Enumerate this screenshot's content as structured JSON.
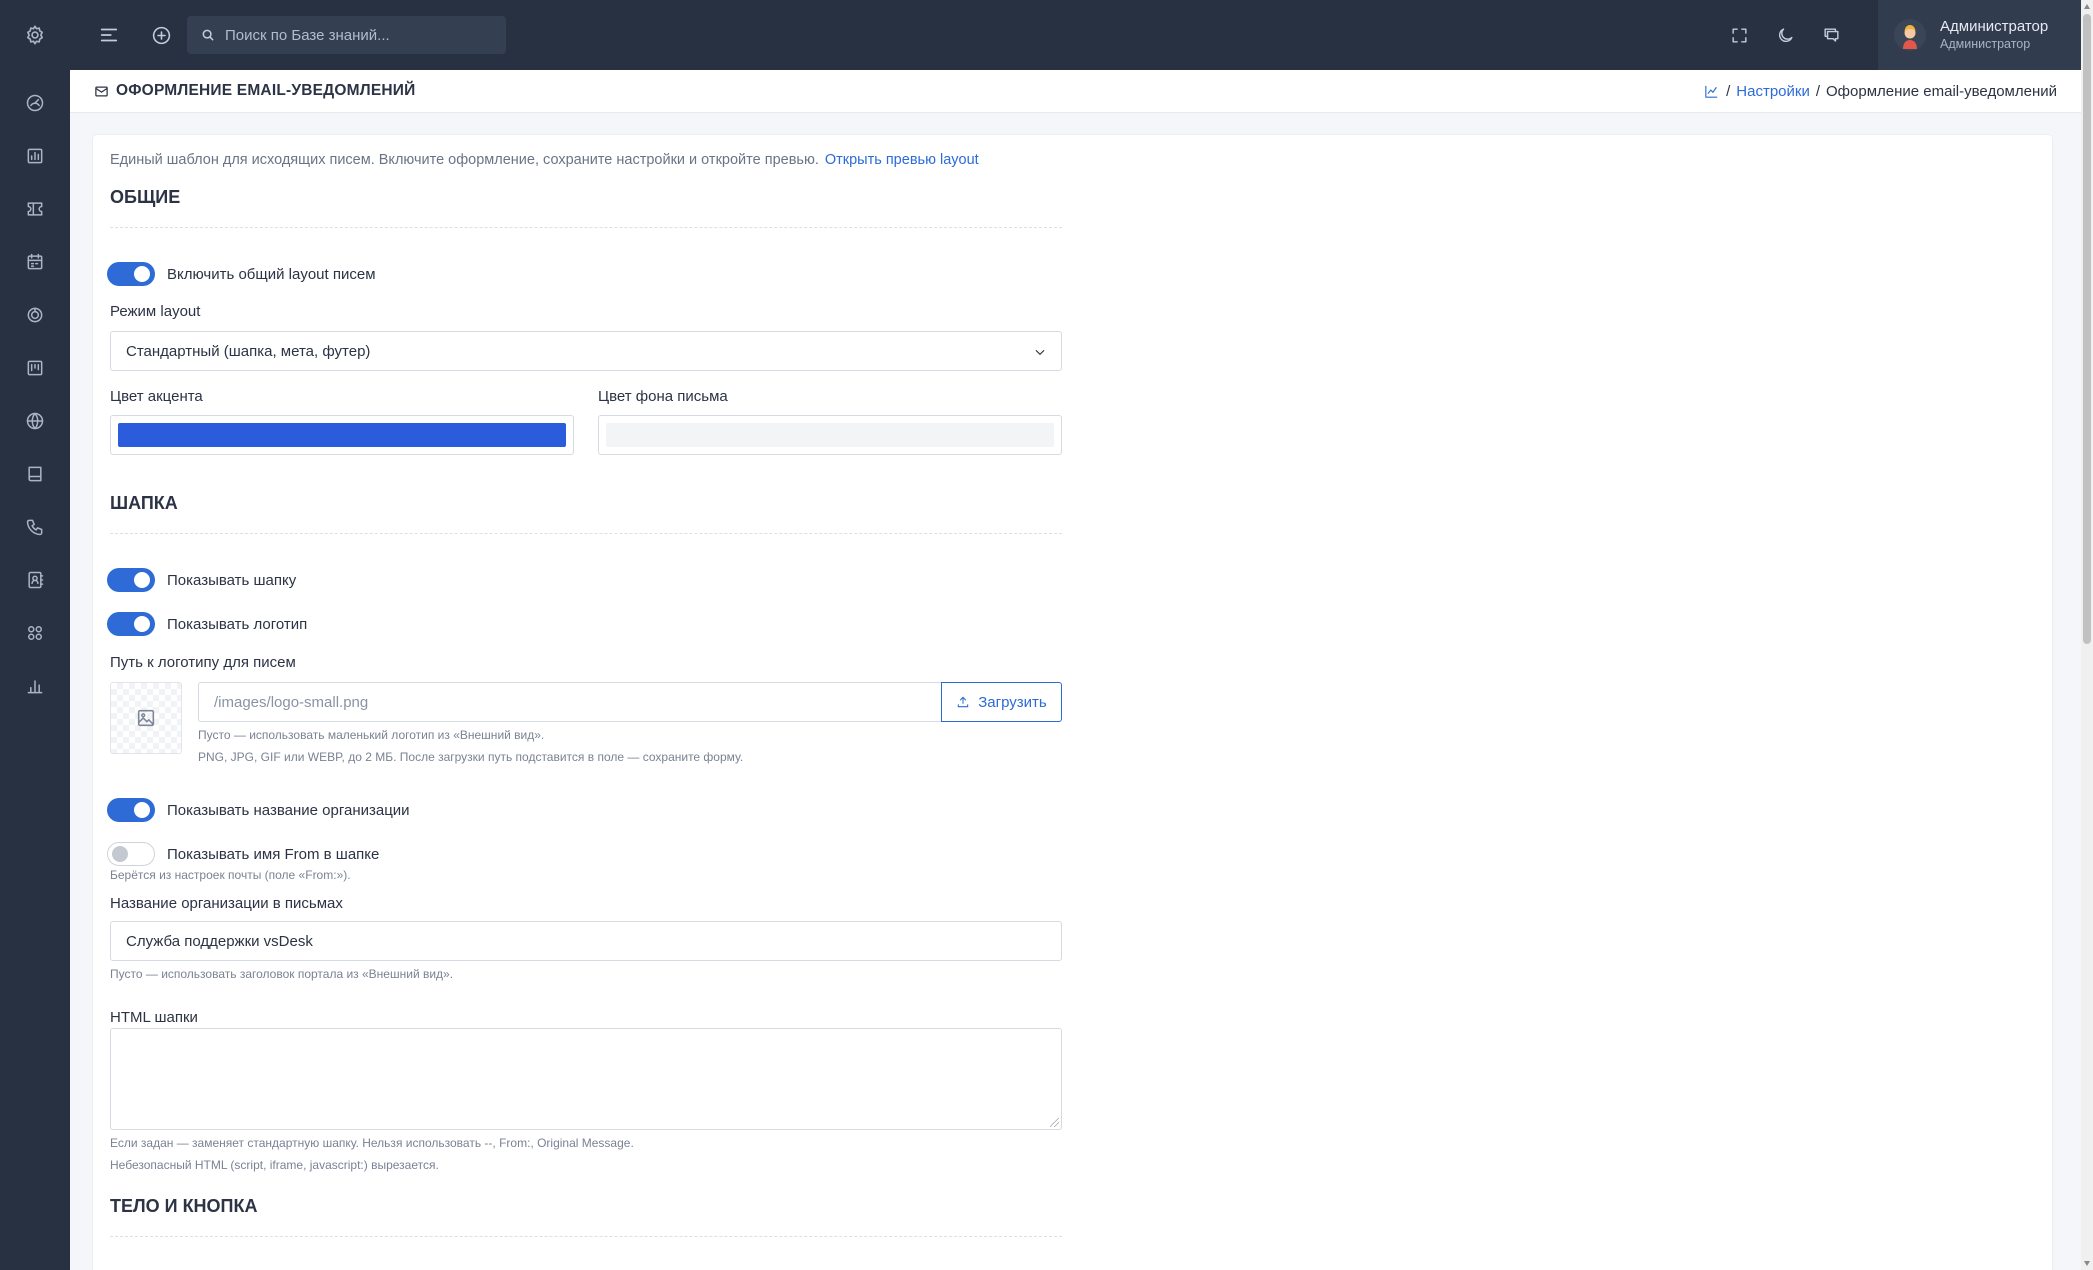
{
  "topbar": {
    "search_placeholder": "Поиск по Базе знаний...",
    "user_name": "Администратор",
    "user_role": "Администратор"
  },
  "rail": {
    "icons": [
      "settings-icon",
      "dashboard-gauge-icon",
      "reports-chart-icon",
      "tickets-icon",
      "calendar-icon",
      "finance-icon",
      "kanban-icon",
      "globe-icon",
      "book-icon",
      "phone-icon",
      "contacts-icon",
      "apps-icon",
      "analytics-bars-icon"
    ]
  },
  "page": {
    "title": "ОФОРМЛЕНИЕ EMAIL-УВЕДОМЛЕНИЙ",
    "breadcrumb_sep": "/",
    "breadcrumb_settings": "Настройки",
    "breadcrumb_current": "Оформление email-уведомлений"
  },
  "form": {
    "intro": "Единый шаблон для исходящих писем. Включите оформление, сохраните настройки и откройте превью.",
    "preview_link": "Открыть превью layout",
    "general": {
      "heading": "ОБЩИЕ",
      "enable_layout_label": "Включить общий layout писем",
      "enable_layout": true,
      "mode_label": "Режим layout",
      "mode_value": "Стандартный (шапка, мета, футер)",
      "accent_label": "Цвет акцента",
      "accent_color": "#2a5cdb",
      "bg_label": "Цвет фона письма",
      "bg_color": "#f3f4f6"
    },
    "header": {
      "heading": "ШАПКА",
      "show_header_label": "Показывать шапку",
      "show_header": true,
      "show_logo_label": "Показывать логотип",
      "show_logo": true,
      "logo_path_label": "Путь к логотипу для писем",
      "logo_path_placeholder": "/images/logo-small.png",
      "upload_label": "Загрузить",
      "logo_help_1": "Пусто — использовать маленький логотип из «Внешний вид».",
      "logo_help_2": "PNG, JPG, GIF или WEBP, до 2 МБ. После загрузки путь подставится в поле — сохраните форму.",
      "show_org_label": "Показывать название организации",
      "show_org": true,
      "show_from_label": "Показывать имя From в шапке",
      "show_from": false,
      "from_help": "Берётся из настроек почты (поле «From:»).",
      "org_name_label": "Название организации в письмах",
      "org_name_value": "Служба поддержки vsDesk",
      "org_help": "Пусто — использовать заголовок портала из «Внешний вид».",
      "html_label": "HTML шапки",
      "html_value": "",
      "html_help_1": "Если задан — заменяет стандартную шапку. Нельзя использовать --, From:, Original Message.",
      "html_help_2": "Небезопасный HTML (script, iframe, javascript:) вырезается."
    },
    "body": {
      "heading": "ТЕЛО И КНОПКА"
    }
  }
}
